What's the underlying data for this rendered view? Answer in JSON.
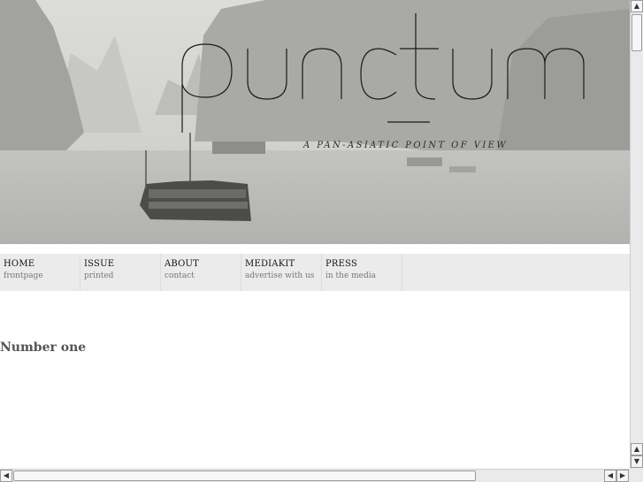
{
  "header": {
    "logo_text": "punctum",
    "tagline": "A PAN-ASIATIC POINT OF VIEW"
  },
  "nav": {
    "items": [
      {
        "title": "HOME",
        "subtitle": "frontpage"
      },
      {
        "title": "ISSUE",
        "subtitle": "printed"
      },
      {
        "title": "ABOUT",
        "subtitle": "contact"
      },
      {
        "title": "MEDIAKIT",
        "subtitle": "advertise with us"
      },
      {
        "title": "PRESS",
        "subtitle": "in the media"
      }
    ]
  },
  "main": {
    "heading": "Number one"
  },
  "scrollbars": {
    "up_arrow": "▲",
    "down_arrow": "▼",
    "left_arrow": "◀",
    "right_arrow": "▶"
  },
  "colors": {
    "nav_bg": "#ebebeb",
    "heading": "#555555"
  }
}
